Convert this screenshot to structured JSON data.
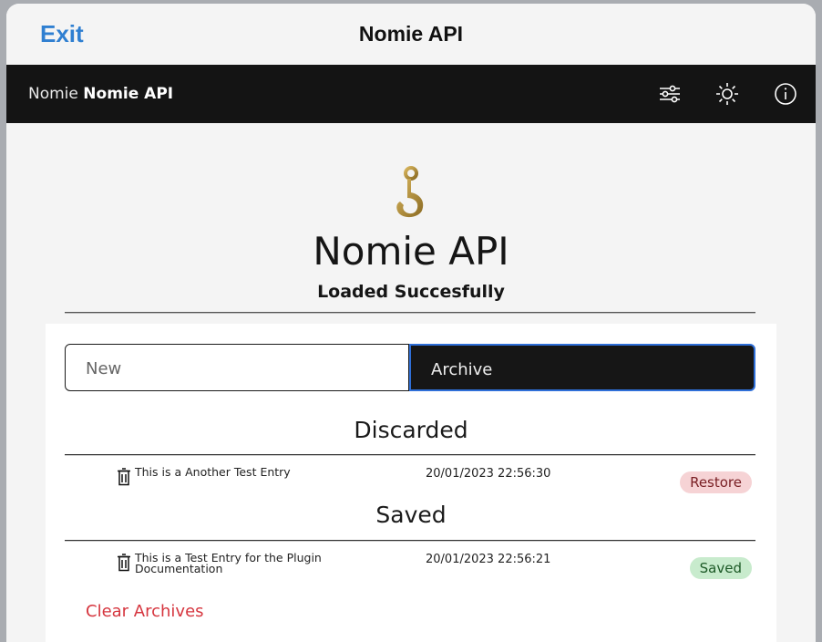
{
  "sheet": {
    "exit_label": "Exit",
    "title": "Nomie API"
  },
  "appbar": {
    "brand_prefix": "Nomie",
    "brand_name": "Nomie API",
    "icons": [
      "sliders-icon",
      "brightness-icon",
      "info-icon"
    ]
  },
  "hero": {
    "icon": "hook-icon",
    "title": "Nomie API",
    "subtitle": "Loaded Succesfully"
  },
  "tabs": [
    {
      "label": "New",
      "active": false
    },
    {
      "label": "Archive",
      "active": true
    }
  ],
  "sections": {
    "discarded": {
      "title": "Discarded",
      "entries": [
        {
          "text": "This is a Another Test Entry",
          "date": "20/01/2023 22:56:30",
          "action": "Restore"
        }
      ]
    },
    "saved": {
      "title": "Saved",
      "entries": [
        {
          "text": "This is a Test Entry for the Plugin Documentation",
          "date": "20/01/2023 22:56:21",
          "action": "Saved"
        }
      ]
    }
  },
  "clear_label": "Clear Archives",
  "colors": {
    "link_blue": "#2f7fd1",
    "appbar": "#141414",
    "danger": "#d6363f",
    "restore_bg": "#f6d3d5",
    "saved_bg": "#c8ebcd",
    "focus": "#2f6fd8"
  }
}
